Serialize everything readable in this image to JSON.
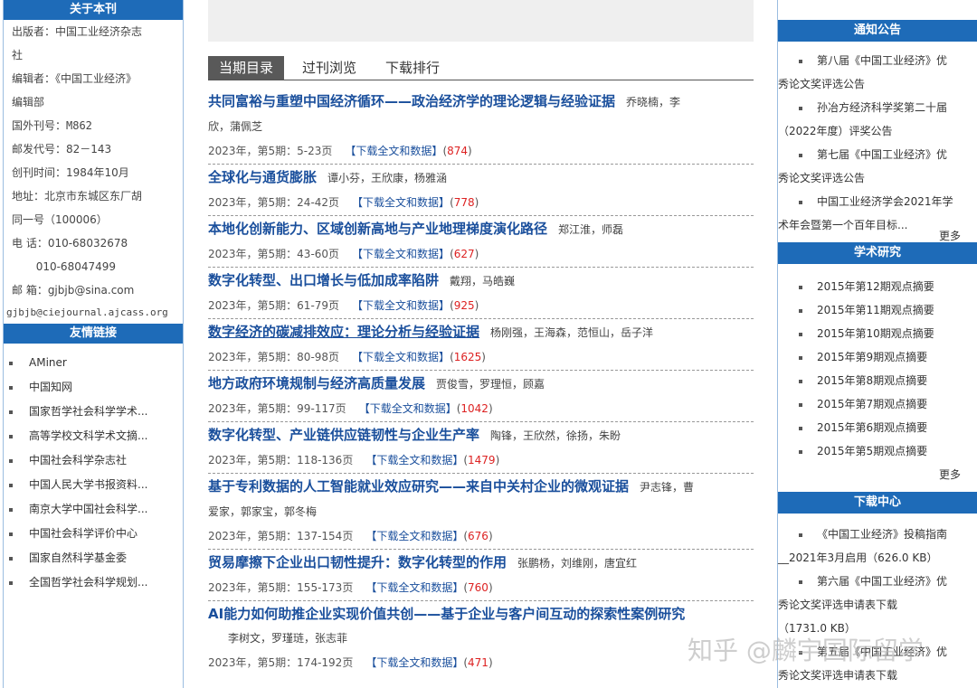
{
  "left": {
    "about_title": "关于本刊",
    "info": [
      "出版者：中国工业经济杂志",
      "社",
      "编辑者：《中国工业经济》",
      "编辑部",
      "国外刊号：M862",
      "邮发代号：82－143",
      "创刊时间：1984年10月",
      "地址：北京市东城区东厂胡",
      "同一号（100006）",
      "电 话：010-68032678",
      "       010-68047499",
      "邮 箱：gjbjb@sina.com",
      "gjbjb@ciejournal.ajcass.org"
    ],
    "links_title": "友情链接",
    "links": [
      "AMiner",
      "中国知网",
      "国家哲学社会科学学术...",
      "高等学校文科学术文摘...",
      "中国社会科学杂志社",
      "中国人民大学书报资料...",
      "南京大学中国社会科学...",
      "中国社会科学评价中心",
      "国家自然科学基金委",
      "全国哲学社会科学规划..."
    ]
  },
  "tabs": [
    "当期目录",
    "过刊浏览",
    "下载排行"
  ],
  "download_label": "【下载全文和数据】",
  "articles": [
    {
      "title": "共同富裕与重塑中国经济循环——政治经济学的理论逻辑与经验证据",
      "authors1": "乔晓楠，李",
      "authors2": "欣，蒲佩芝",
      "meta": "2023年，第5期：5-23页",
      "count": "874"
    },
    {
      "title": "全球化与通货膨胀",
      "authors1": "谭小芬，王欣康，杨雅涵",
      "meta": "2023年，第5期：24-42页",
      "count": "778"
    },
    {
      "title": "本地化创新能力、区域创新高地与产业地理梯度演化路径",
      "authors1": "郑江淮，师磊",
      "meta": "2023年，第5期：43-60页",
      "count": "627"
    },
    {
      "title": "数字化转型、出口增长与低加成率陷阱",
      "authors1": "戴翔，马皓巍",
      "meta": "2023年，第5期：61-79页",
      "count": "925"
    },
    {
      "title": "数字经济的碳减排效应：理论分析与经验证据",
      "authors1": "杨刚强，王海森，范恒山，岳子洋",
      "meta": "2023年，第5期：80-98页",
      "count": "1625"
    },
    {
      "title": "地方政府环境规制与经济高质量发展",
      "authors1": "贾俊雪，罗理恒，顾嘉",
      "meta": "2023年，第5期：99-117页",
      "count": "1042"
    },
    {
      "title": "数字化转型、产业链供应链韧性与企业生产率",
      "authors1": "陶锋，王欣然，徐扬，朱盼",
      "meta": "2023年，第5期：118-136页",
      "count": "1479"
    },
    {
      "title": "基于专利数据的人工智能就业效应研究——来自中关村企业的微观证据",
      "authors1": "尹志锋，曹",
      "authors2": "爱家，郭家宝，郭冬梅",
      "meta": "2023年，第5期：137-154页",
      "count": "676"
    },
    {
      "title": "贸易摩擦下企业出口韧性提升：数字化转型的作用",
      "authors1": "张鹏杨，刘维刚，唐宜红",
      "meta": "2023年，第5期：155-173页",
      "count": "760"
    },
    {
      "title": "AI能力如何助推企业实现价值共创——基于企业与客户间互动的探索性案例研究",
      "authors1": "",
      "authors2": "李树文，罗瑾琏，张志菲",
      "meta": "2023年，第5期：174-192页",
      "count": "471"
    }
  ],
  "right": {
    "notice_title": "通知公告",
    "notices": [
      {
        "l1": "第八届《中国工业经济》优",
        "l2": "秀论文奖评选公告"
      },
      {
        "l1": "孙冶方经济科学奖第二十届",
        "l2": "（2022年度）评奖公告"
      },
      {
        "l1": "第七届《中国工业经济》优",
        "l2": "秀论文奖评选公告"
      },
      {
        "l1": "中国工业经济学会2021年学",
        "l2": "术年会暨第一个百年目标..."
      }
    ],
    "more": "更多",
    "research_title": "学术研究",
    "research": [
      "2015年第12期观点摘要",
      "2015年第11期观点摘要",
      "2015年第10期观点摘要",
      "2015年第9期观点摘要",
      "2015年第8期观点摘要",
      "2015年第7期观点摘要",
      "2015年第6期观点摘要",
      "2015年第5期观点摘要"
    ],
    "download_title": "下载中心",
    "downloads": [
      {
        "l1": "《中国工业经济》投稿指南",
        "l2": "__2021年3月启用（626.0 KB）"
      },
      {
        "l1": "第六届《中国工业经济》优",
        "l2": "秀论文奖评选申请表下载",
        "l3": "（1731.0 KB）"
      },
      {
        "l1": "第五届《中国工业经济》优",
        "l2": "秀论文奖评选申请表下载"
      }
    ]
  },
  "watermark": "知乎 @麟宇国际留学"
}
